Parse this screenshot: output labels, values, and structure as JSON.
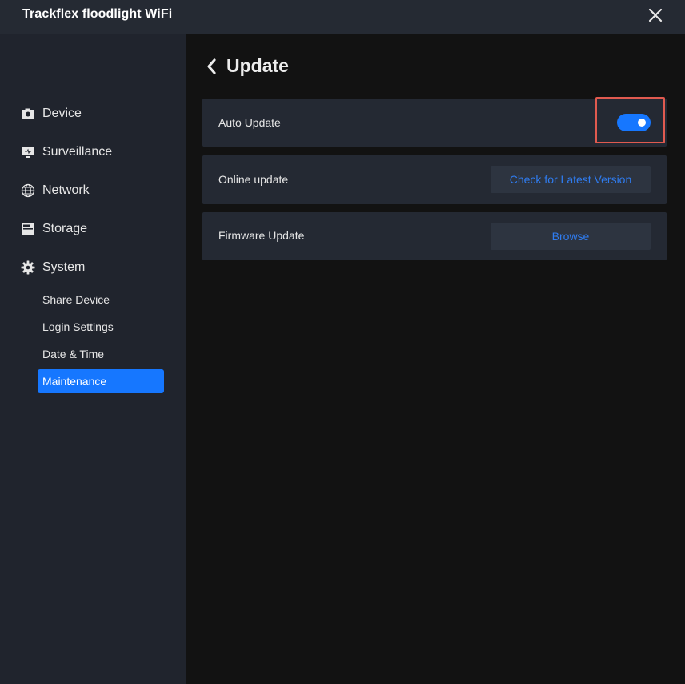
{
  "app": {
    "title": "Trackflex floodlight WiFi"
  },
  "sidebar": {
    "items": [
      {
        "label": "Device",
        "icon": "camera-icon"
      },
      {
        "label": "Surveillance",
        "icon": "monitor-icon"
      },
      {
        "label": "Network",
        "icon": "globe-icon"
      },
      {
        "label": "Storage",
        "icon": "storage-icon"
      },
      {
        "label": "System",
        "icon": "gear-icon"
      }
    ],
    "subitems": [
      {
        "label": "Share Device"
      },
      {
        "label": "Login Settings"
      },
      {
        "label": "Date & Time"
      },
      {
        "label": "Maintenance",
        "active": true
      }
    ]
  },
  "page": {
    "title": "Update",
    "rows": [
      {
        "label": "Auto Update",
        "toggle_on": true
      },
      {
        "label": "Online update",
        "button": "Check for Latest Version"
      },
      {
        "label": "Firmware Update",
        "button": "Browse"
      }
    ]
  },
  "colors": {
    "accent": "#1677ff",
    "link_text": "#2f7cf0",
    "highlight_box": "#e05a4f",
    "sidebar_bg": "#20242d",
    "main_bg": "#121212",
    "row_bg": "#242933"
  }
}
